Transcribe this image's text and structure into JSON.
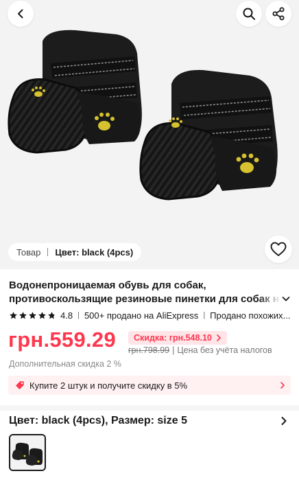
{
  "hero": {
    "back_icon": "chevron-left-icon",
    "search_icon": "search-icon",
    "share_icon": "share-icon",
    "wishlist_icon": "heart-icon",
    "image": "black dog boots with yellow paw print"
  },
  "variant_pill": {
    "tab_label": "Товар",
    "color_label": "Цвет: black (4pcs)"
  },
  "product": {
    "title_line1": "Водонепроницаемая обувь для собак,",
    "title_line2": "противоскользящие резиновые пинетки для собак на ле",
    "rating": "4.8",
    "stars": 4.8,
    "sold": "500+ продано на AliExpress",
    "similar": "Продано похожих..."
  },
  "pricing": {
    "price": "грн.559.29",
    "discount_badge": "Скидка: грн.548.10",
    "old_price": "грн.798.99",
    "tax_note": "Цена без учёта налогов",
    "extra_discount": "Дополнительная скидка 2 %"
  },
  "promo": {
    "text": "Купите 2 штук и получите скидку в 5%"
  },
  "spec": {
    "label": "Цвет: black (4pcs), Размер: size 5"
  },
  "colors": {
    "accent": "#fd384f",
    "badge_bg": "#ffe4e8",
    "promo_bg": "#fff0f2",
    "star": "#191919",
    "boot_black": "#1a1a1a",
    "paw_yellow": "#d6c22e"
  }
}
